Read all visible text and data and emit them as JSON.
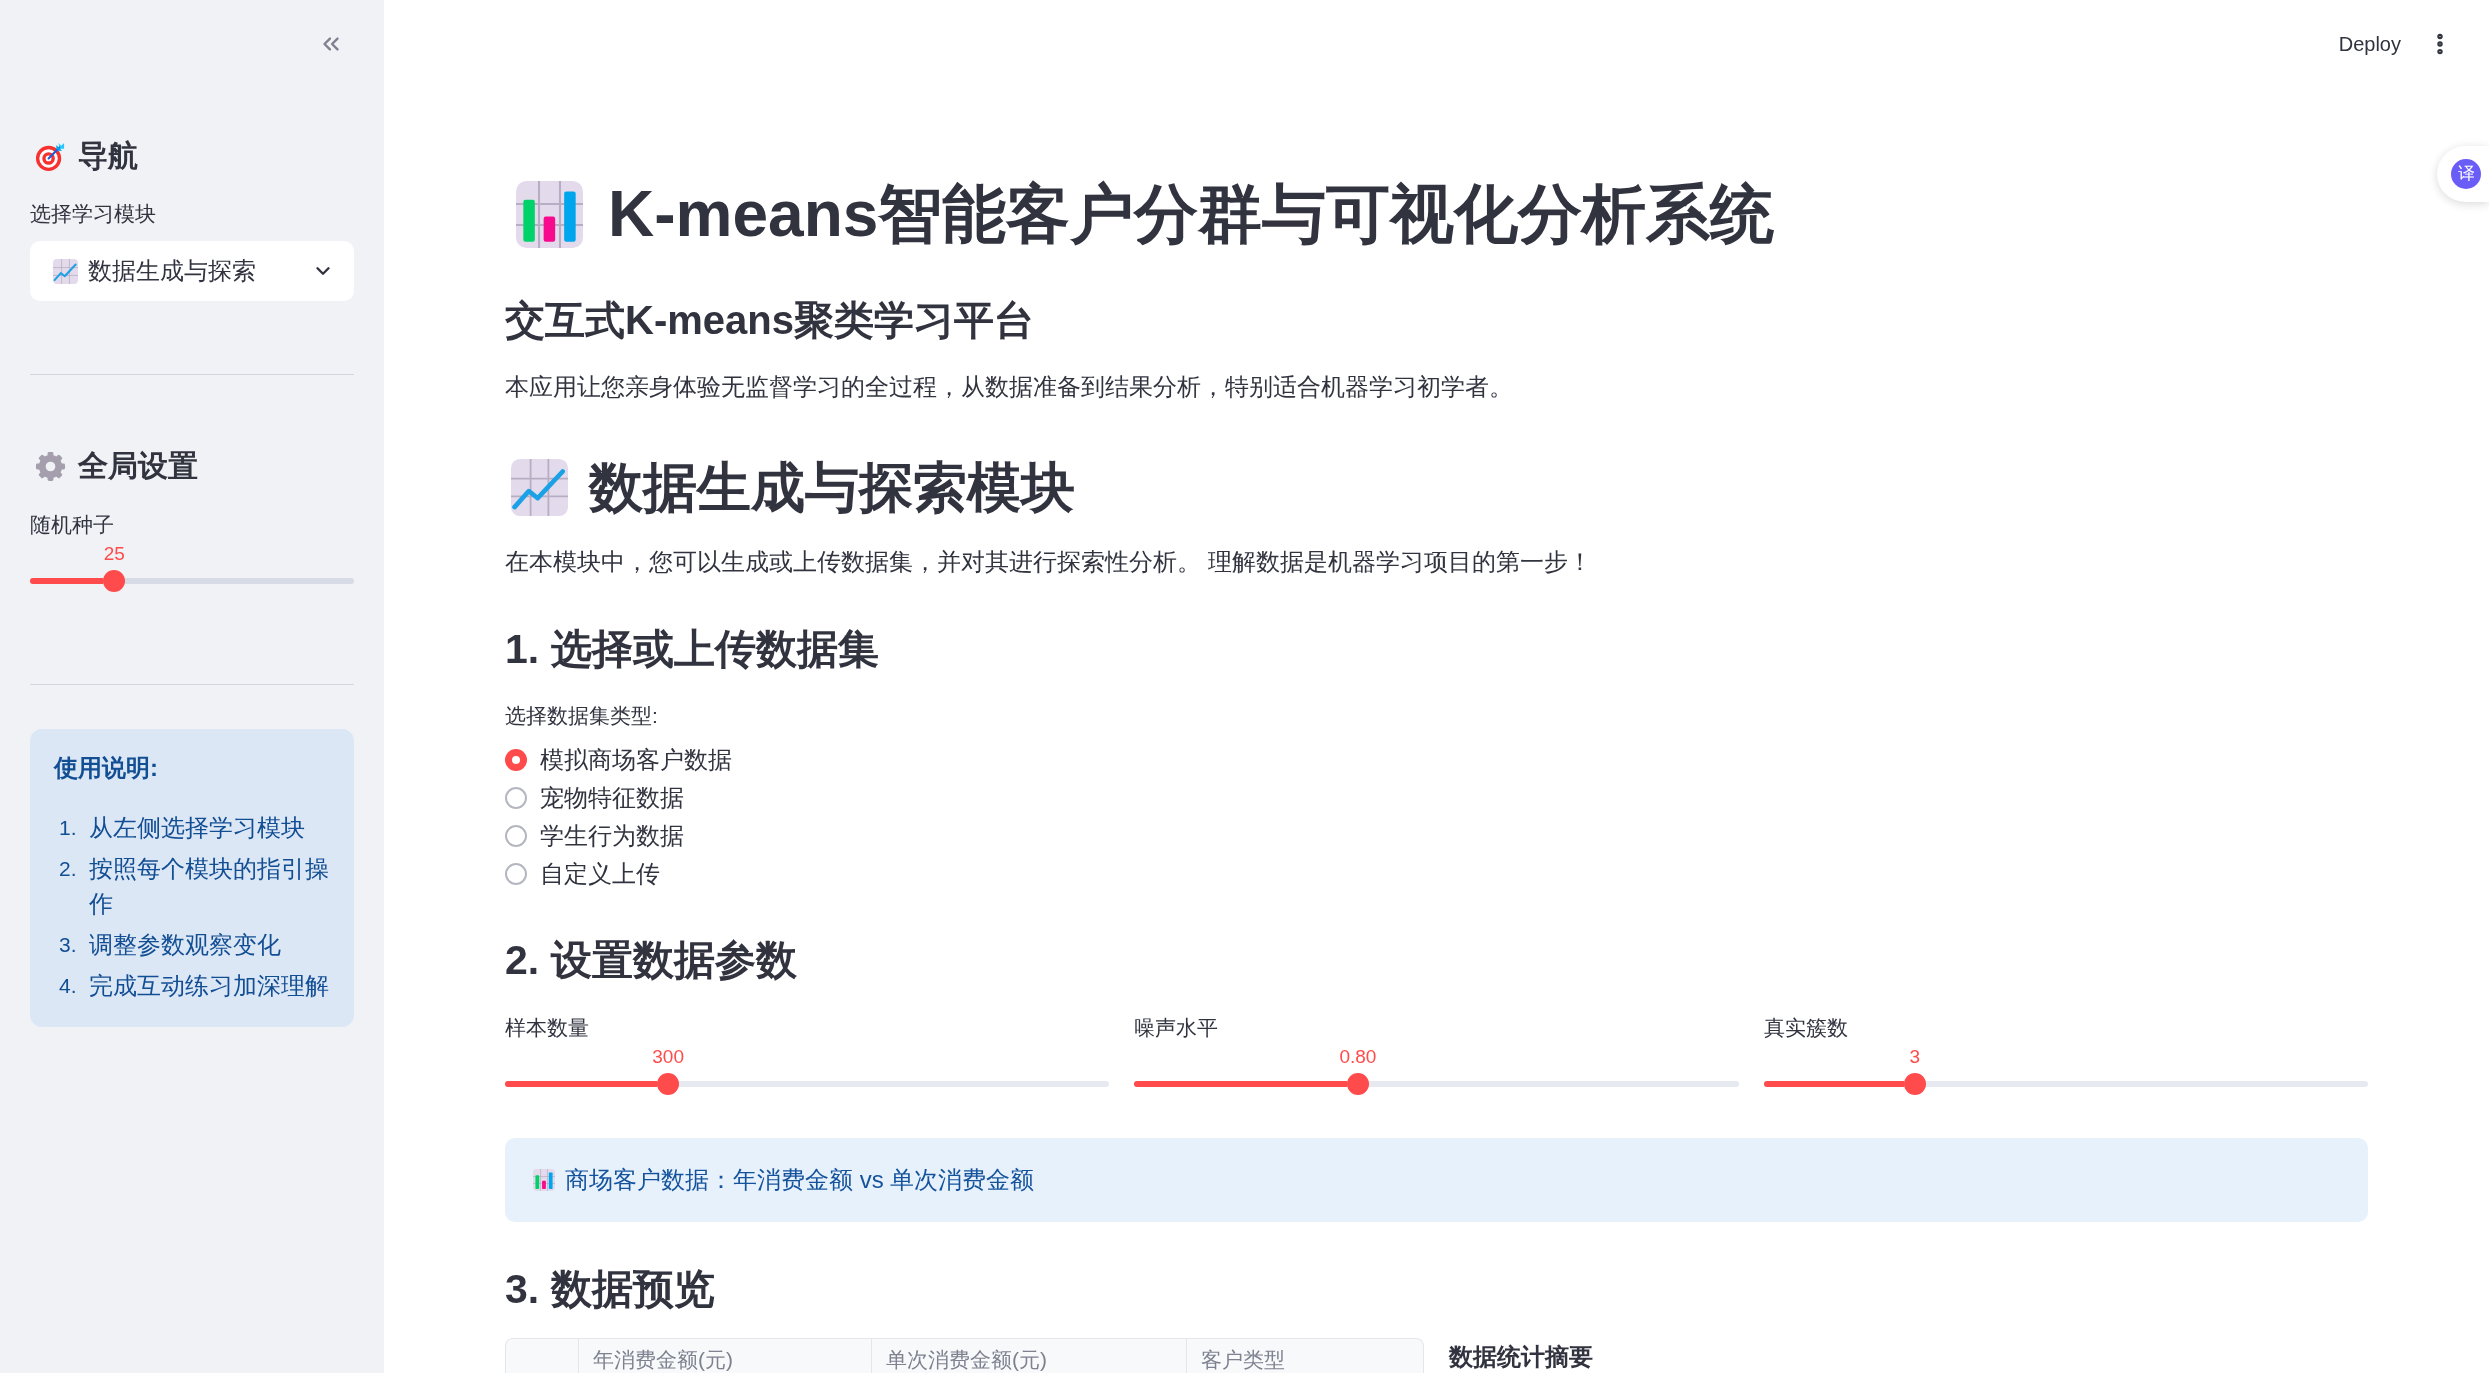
{
  "top_bar": {
    "deploy_button": "Deploy"
  },
  "translate_widget": {
    "label": "译"
  },
  "sidebar": {
    "navigation": {
      "heading": "导航",
      "select_label": "选择学习模块",
      "select_value": "数据生成与探索"
    },
    "global_settings": {
      "heading": "全局设置",
      "slider": {
        "label": "随机种子",
        "reading": "25",
        "level": 0.26
      }
    },
    "instructions": {
      "title": "使用说明:",
      "items": [
        {
          "marker": "1.",
          "text": "从左侧选择学习模块"
        },
        {
          "marker": "2.",
          "text": "按照每个模块的指引操作"
        },
        {
          "marker": "3.",
          "text": "调整参数观察变化"
        },
        {
          "marker": "4.",
          "text": "完成互动练习加深理解"
        }
      ]
    }
  },
  "main": {
    "title": "K-means智能客户分群与可视化分析系统",
    "subtitle": "交互式K-means聚类学习平台",
    "intro": "本应用让您亲身体验无监督学习的全过程，从数据准备到结果分析，特别适合机器学习初学者。",
    "module": {
      "heading": "数据生成与探索模块",
      "intro": "在本模块中，您可以生成或上传数据集，并对其进行探索性分析。 理解数据是机器学习项目的第一步！"
    },
    "dataset": {
      "heading": "1. 选择或上传数据集",
      "label": "选择数据集类型:",
      "options": [
        {
          "label": "模拟商场客户数据",
          "selected": true
        },
        {
          "label": "宠物特征数据",
          "selected": false
        },
        {
          "label": "学生行为数据",
          "selected": false
        },
        {
          "label": "自定义上传",
          "selected": false
        }
      ]
    },
    "parameters": {
      "heading": "2. 设置数据参数",
      "sliders": [
        {
          "label": "样本数量",
          "reading": "300",
          "level": 0.27
        },
        {
          "label": "噪声水平",
          "reading": "0.80",
          "level": 0.37
        },
        {
          "label": "真实簇数",
          "reading": "3",
          "level": 0.25
        }
      ]
    },
    "info": {
      "text": "商场客户数据：年消费金额 vs 单次消费金额"
    },
    "preview": {
      "heading": "3. 数据预览",
      "table": {
        "columns": [
          "年消费金额(元)",
          "单次消费金额(元)",
          "客户类型"
        ]
      },
      "summary_heading": "数据统计摘要"
    }
  }
}
